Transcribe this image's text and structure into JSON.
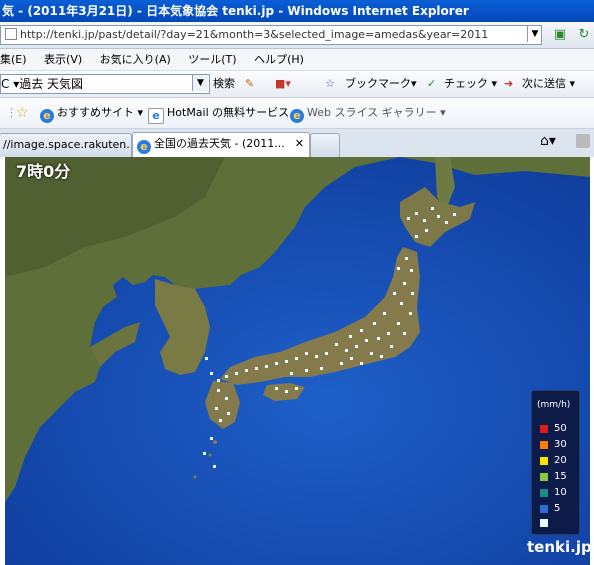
{
  "window": {
    "title": "気 - (2011年3月21日) - 日本気象協会 tenki.jp - Windows Internet Explorer"
  },
  "address": {
    "url": "http://tenki.jp/past/detail/?day=21&month=3&selected_image=amedas&year=2011"
  },
  "menu": {
    "items": [
      "集(E)",
      "表示(V)",
      "お気に入り(A)",
      "ツール(T)",
      "ヘルプ(H)"
    ]
  },
  "toolbar": {
    "search_text": "C ▾過去  天気図",
    "search_button": "検索",
    "bookmark": "ブックマーク▾",
    "check": "チェック ▾",
    "send": "次に送信 ▾"
  },
  "favorites": {
    "recommended": "おすすめサイト ▾",
    "hotmail": "HotMail の無料サービス",
    "webslice": "Web スライス ギャラリー ▾"
  },
  "tabs": [
    {
      "label": "//image.space.rakuten..."
    },
    {
      "label": "全国の過去天気 - (2011..."
    }
  ],
  "map": {
    "time_label": "7時0分",
    "legend": {
      "title": "(mm/h)",
      "items": [
        {
          "label": "50",
          "color": "#e31a1c"
        },
        {
          "label": "30",
          "color": "#ff7f00"
        },
        {
          "label": "20",
          "color": "#ffe300"
        },
        {
          "label": "15",
          "color": "#8cc63f"
        },
        {
          "label": "10",
          "color": "#1a8a8a"
        },
        {
          "label": "5",
          "color": "#2b6fd6"
        },
        {
          "label": "",
          "color": "#e8ffff"
        }
      ]
    },
    "logo": "tenki.jp"
  }
}
